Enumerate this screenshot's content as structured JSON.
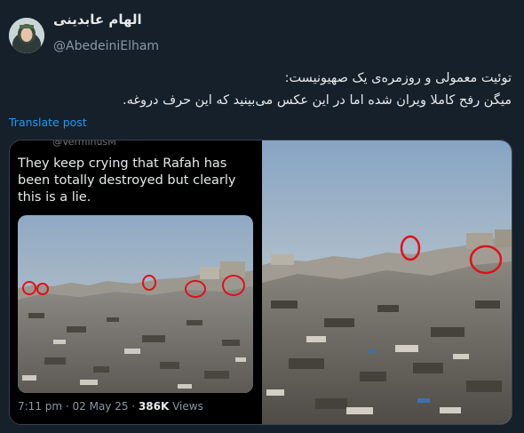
{
  "author": {
    "display_name": "الهام عابدینی",
    "handle": "@AbedeiniElham"
  },
  "post": {
    "lines": [
      "توئیت معمولی و روزمره‌ی یک صهیونیست:",
      "میگن رفح کاملا ویران شده اما در این عکس می‌بینید که این حرف دروغه."
    ],
    "translate_label": "Translate post"
  },
  "quoted": {
    "handle": "@VerminusM",
    "text": "They keep crying that Rafah has been totally destroyed but clearly this is a lie.",
    "time": "7:11 pm · 02 May 25 · ",
    "views_count": "386K",
    "views_label": " Views"
  },
  "colors": {
    "background": "#15202b",
    "link": "#1d9bf0",
    "circle": "#e0101a"
  }
}
